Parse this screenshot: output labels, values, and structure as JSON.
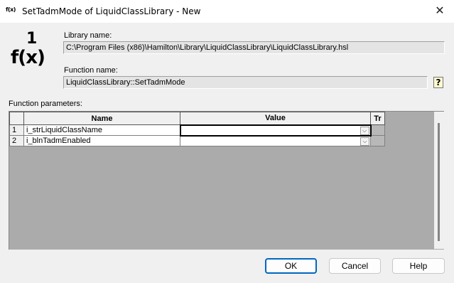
{
  "window": {
    "icon_text": "f(x)",
    "title": "SetTadmMode of LiquidClassLibrary - New",
    "close_glyph": "✕"
  },
  "logo": {
    "top": "1",
    "bottom": "f(x)"
  },
  "library": {
    "label": "Library name:",
    "value": "C:\\Program Files (x86)\\Hamilton\\Library\\LiquidClassLibrary\\LiquidClassLibrary.hsl"
  },
  "function": {
    "label": "Function name:",
    "value": "LiquidClassLibrary::SetTadmMode",
    "help_glyph": "?"
  },
  "parameters": {
    "label": "Function parameters:",
    "columns": {
      "name": "Name",
      "value": "Value",
      "tr": "Tr"
    },
    "rows": [
      {
        "num": "1",
        "name": "i_strLiquidClassName",
        "value": ""
      },
      {
        "num": "2",
        "name": "i_blnTadmEnabled",
        "value": ""
      }
    ],
    "dropdown_glyph": "⌵"
  },
  "buttons": {
    "ok": "OK",
    "cancel": "Cancel",
    "help": "Help"
  }
}
